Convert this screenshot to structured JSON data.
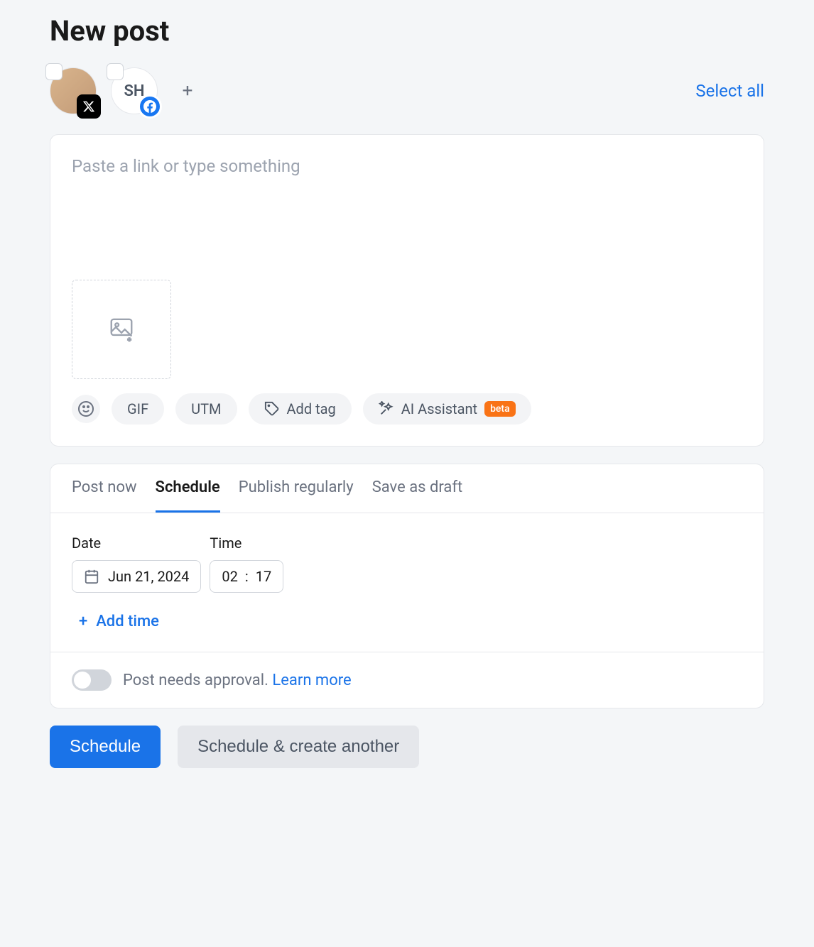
{
  "header": {
    "title": "New post"
  },
  "accounts": {
    "items": [
      {
        "initials": "",
        "platform": "x"
      },
      {
        "initials": "SH",
        "platform": "facebook"
      }
    ],
    "select_all": "Select all"
  },
  "composer": {
    "placeholder": "Paste a link or type something",
    "tools": {
      "gif": "GIF",
      "utm": "UTM",
      "add_tag": "Add tag",
      "ai_assistant": "AI Assistant",
      "beta": "beta"
    }
  },
  "tabs": [
    {
      "label": "Post now",
      "active": false
    },
    {
      "label": "Schedule",
      "active": true
    },
    {
      "label": "Publish regularly",
      "active": false
    },
    {
      "label": "Save as draft",
      "active": false
    }
  ],
  "schedule": {
    "date_label": "Date",
    "date_value": "Jun 21, 2024",
    "time_label": "Time",
    "time_hour": "02",
    "time_minute": "17",
    "time_sep": ":",
    "add_time": "Add time"
  },
  "approval": {
    "text": "Post needs approval.",
    "learn_more": "Learn more"
  },
  "actions": {
    "schedule": "Schedule",
    "schedule_another": "Schedule & create another"
  }
}
